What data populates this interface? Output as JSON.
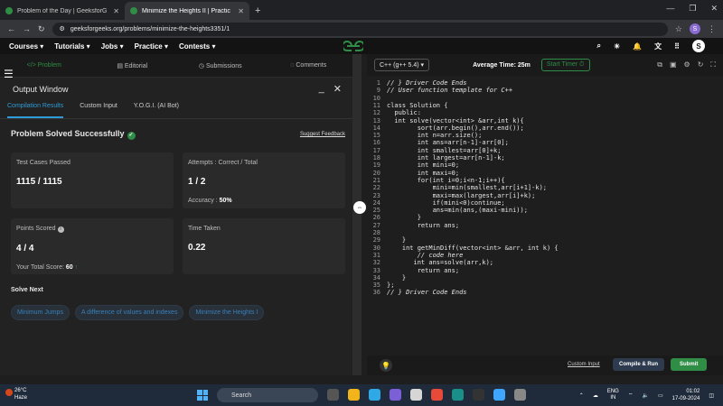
{
  "browser": {
    "tabs": [
      {
        "title": "Problem of the Day | GeeksforG",
        "active": false
      },
      {
        "title": "Minimize the Heights II | Practic",
        "active": true
      }
    ],
    "url": "geeksforgeeks.org/problems/minimize-the-heights3351/1",
    "profile_letter": "S"
  },
  "site_nav": {
    "items": [
      "Courses",
      "Tutorials",
      "Jobs",
      "Practice",
      "Contests"
    ],
    "logo": "GfG",
    "avatar_letter": "S"
  },
  "left_tabs": [
    "Problem",
    "Editorial",
    "Submissions",
    "Comments"
  ],
  "output_window": {
    "title": "Output Window",
    "tabs": [
      "Compilation Results",
      "Custom Input",
      "Y.O.G.I. (AI Bot)"
    ],
    "status": "Problem Solved Successfully",
    "suggest_feedback": "Suggest Feedback",
    "cards": {
      "test_cases_label": "Test Cases Passed",
      "test_cases_value": "1115 / 1115",
      "attempts_label": "Attempts : Correct / Total",
      "attempts_value": "1 / 2",
      "accuracy_label": "Accuracy :",
      "accuracy_value": "50%",
      "points_label": "Points Scored",
      "points_value": "4 / 4",
      "total_score_label": "Your Total Score:",
      "total_score_value": "60",
      "time_label": "Time Taken",
      "time_value": "0.22"
    },
    "solve_next_label": "Solve Next",
    "solve_next": [
      "Minimum Jumps",
      "A difference of values and indexes",
      "Minimize the Heights I"
    ]
  },
  "editor": {
    "language": "C++ (g++ 5.4)",
    "avg_time": "Average Time: 25m",
    "start_timer": "Start Timer",
    "lines": [
      {
        "n": "1",
        "t": "// } Driver Code Ends"
      },
      {
        "n": "9",
        "t": "// User function template for C++"
      },
      {
        "n": "10",
        "t": ""
      },
      {
        "n": "11",
        "t": "class Solution {"
      },
      {
        "n": "12",
        "t": "  public:"
      },
      {
        "n": "13",
        "t": "  int solve(vector<int> &arr,int k){"
      },
      {
        "n": "14",
        "t": "        sort(arr.begin(),arr.end());"
      },
      {
        "n": "15",
        "t": "        int n=arr.size();"
      },
      {
        "n": "16",
        "t": "        int ans=arr[n-1]-arr[0];"
      },
      {
        "n": "17",
        "t": "        int smallest=arr[0]+k;"
      },
      {
        "n": "18",
        "t": "        int largest=arr[n-1]-k;"
      },
      {
        "n": "19",
        "t": "        int mini=0;"
      },
      {
        "n": "20",
        "t": "        int maxi=0;"
      },
      {
        "n": "21",
        "t": "        for(int i=0;i<n-1;i++){"
      },
      {
        "n": "22",
        "t": "            mini=min(smallest,arr[i+1]-k);"
      },
      {
        "n": "23",
        "t": "            maxi=max(largest,arr[i]+k);"
      },
      {
        "n": "24",
        "t": "            if(mini<0)continue;"
      },
      {
        "n": "25",
        "t": "            ans=min(ans,(maxi-mini));"
      },
      {
        "n": "26",
        "t": "        }"
      },
      {
        "n": "27",
        "t": "        return ans;"
      },
      {
        "n": "28",
        "t": ""
      },
      {
        "n": "29",
        "t": "    }"
      },
      {
        "n": "30",
        "t": "    int getMinDiff(vector<int> &arr, int k) {"
      },
      {
        "n": "31",
        "t": "        // code here"
      },
      {
        "n": "32",
        "t": "       int ans=solve(arr,k);"
      },
      {
        "n": "33",
        "t": "        return ans;"
      },
      {
        "n": "34",
        "t": "    }"
      },
      {
        "n": "35",
        "t": "};"
      },
      {
        "n": "36",
        "t": "// } Driver Code Ends"
      }
    ],
    "custom_input": "Custom Input",
    "compile_run": "Compile & Run",
    "submit": "Submit"
  },
  "taskbar": {
    "weather_temp": "26°C",
    "weather_desc": "Haze",
    "search": "Search",
    "lang": "ENG",
    "lang_region": "IN",
    "time": "01:02",
    "date": "17-09-2024"
  }
}
